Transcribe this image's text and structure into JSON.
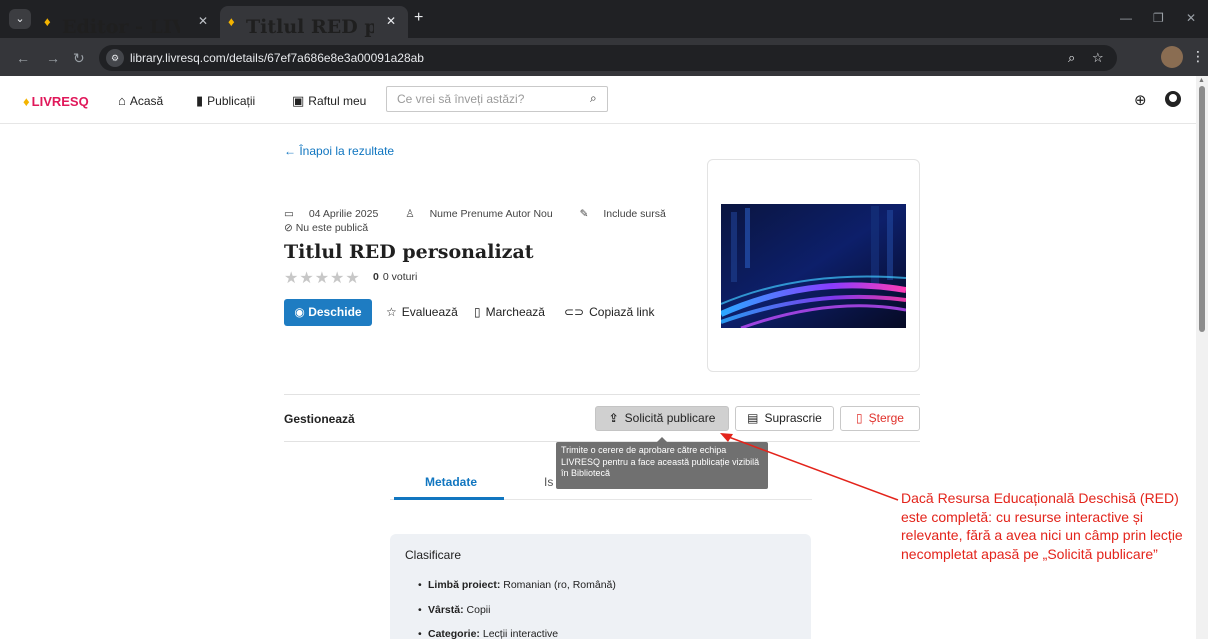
{
  "browser": {
    "tabs": [
      {
        "title": "Editor - LIVRESQ",
        "active": false
      },
      {
        "title": "Titlul RED personalizat - LIVRESQ",
        "active": true
      }
    ],
    "url": "library.livresq.com/details/67ef7a686e8e3a00091a28ab"
  },
  "nav": {
    "logo": "LIVRESQ",
    "home": "Acasă",
    "publications": "Publicații",
    "shelf": "Raftul meu",
    "search_placeholder": "Ce vrei să înveți astăzi?"
  },
  "details": {
    "back": "Înapoi la rezultate",
    "date": "04 Aprilie 2025",
    "author": "Nume Prenume Autor Nou",
    "source": "Include sursă",
    "visibility": "Nu este publică",
    "title": "Titlul RED personalizat",
    "rating_value": "0",
    "rating_votes": "0 voturi",
    "rating_stars": 0,
    "actions": {
      "open": "Deschide",
      "rate": "Evaluează",
      "bookmark": "Marchează",
      "copy": "Copiază link"
    }
  },
  "manage": {
    "label": "Gestionează",
    "request": "Solicită publicare",
    "overwrite": "Suprascrie",
    "delete": "Șterge",
    "tooltip": "Trimite o cerere de aprobare către echipa LIVRESQ pentru a face această publicație vizibilă în Bibliotecă"
  },
  "tabs": {
    "metadata": "Metadate",
    "other": "Is"
  },
  "classification": {
    "title": "Clasificare",
    "items": [
      {
        "label": "Limbă proiect:",
        "value": " Romanian (ro, Română)"
      },
      {
        "label": "Vârstă:",
        "value": " Copii"
      },
      {
        "label": "Categorie:",
        "value": " Lecții interactive"
      }
    ]
  },
  "annotation": "Dacă Resursa Educațională Deschisă (RED) este completă: cu resurse interactive și relevante, fără a avea nici un câmp prin lecție necompletat apasă pe „Solicită publicare”",
  "colors": {
    "accent": "#1e7cc2",
    "brand": "#e0185a",
    "annotation": "#e3241b",
    "danger": "#e0302a"
  }
}
